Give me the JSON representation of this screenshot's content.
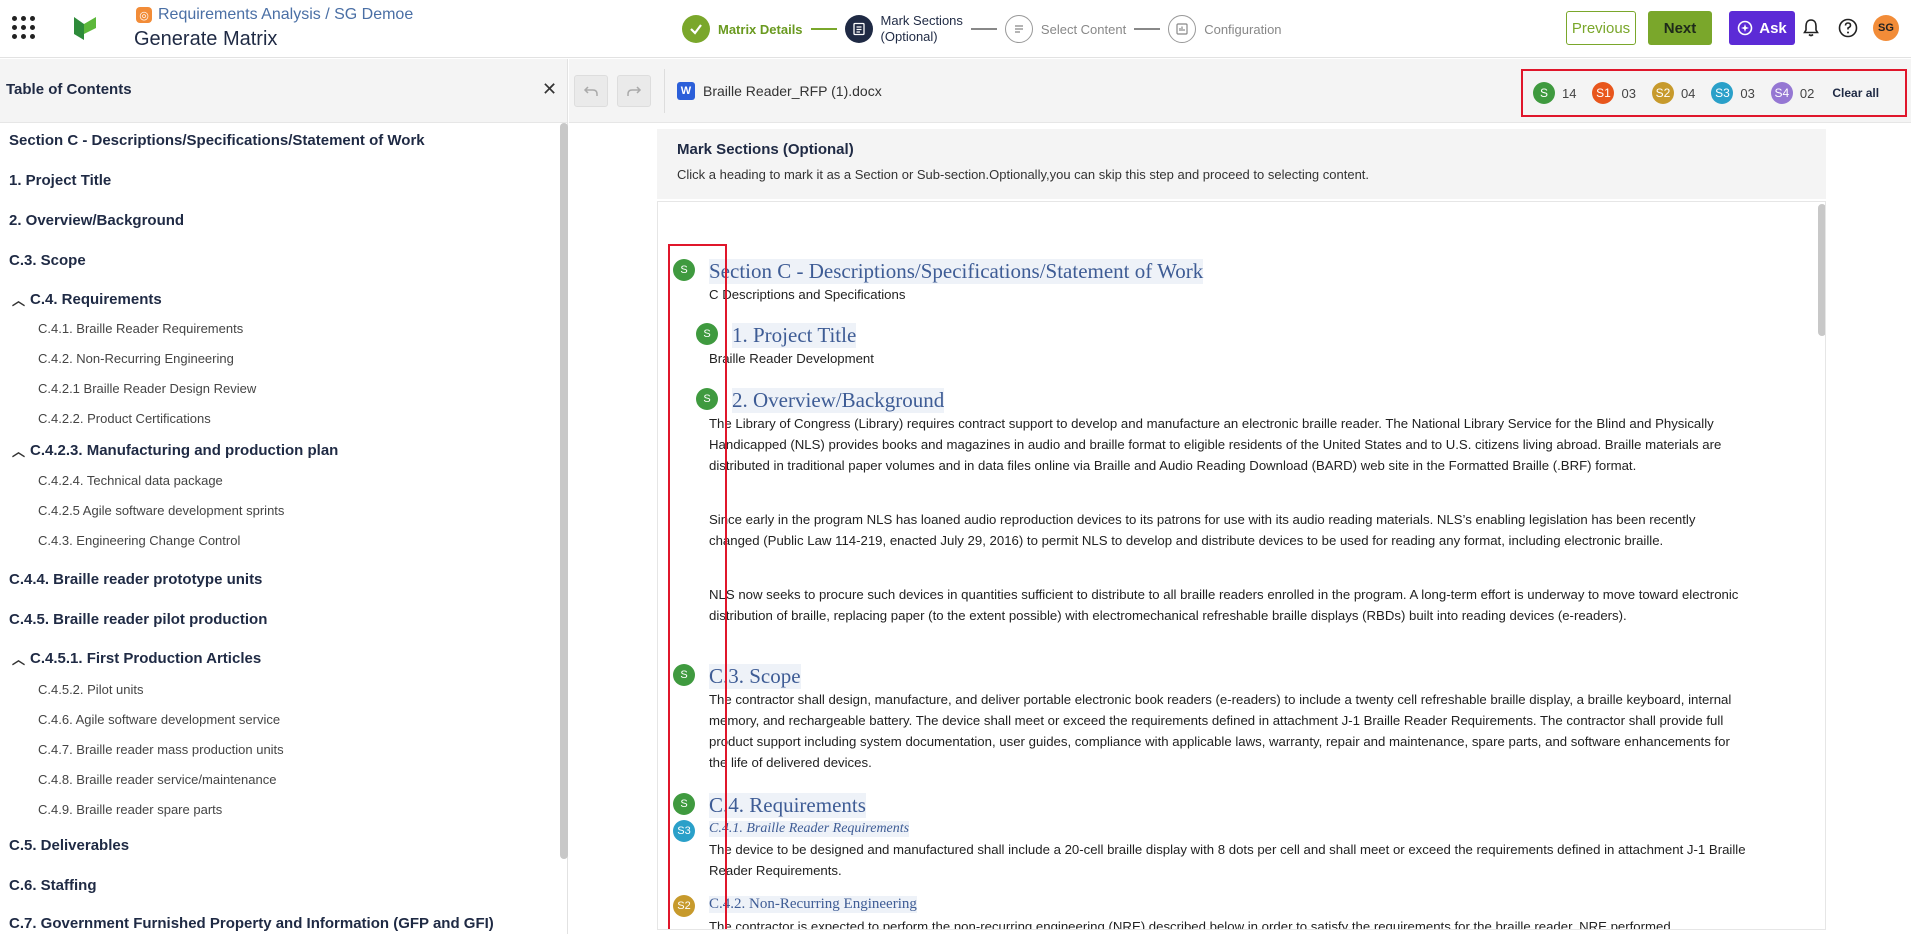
{
  "header": {
    "breadcrumb": "Requirements Analysis / SG Demoe",
    "title": "Generate Matrix",
    "steps": [
      {
        "label": "Matrix Details",
        "state": "done"
      },
      {
        "label_line1": "Mark Sections",
        "label_line2": "(Optional)",
        "state": "active"
      },
      {
        "label": "Select Content",
        "state": "todo"
      },
      {
        "label": "Configuration",
        "state": "todo"
      }
    ],
    "previous_label": "Previous",
    "next_label": "Next",
    "ask_label": "Ask",
    "avatar_initials": "SG",
    "colors": {
      "accent": "#7aa72b",
      "ask": "#5c2bd6",
      "avatar": "#f28c38"
    }
  },
  "sidebar": {
    "title": "Table of Contents",
    "items": [
      {
        "label": "Section C - Descriptions/Specifications/Statement of Work",
        "level": 1
      },
      {
        "label": "1. Project Title",
        "level": 1
      },
      {
        "label": "2. Overview/Background",
        "level": 1
      },
      {
        "label": "C.3. Scope",
        "level": 1
      },
      {
        "label": "C.4. Requirements",
        "level": 1,
        "expanded": true
      },
      {
        "label": "C.4.1. Braille Reader Requirements",
        "level": 2
      },
      {
        "label": "C.4.2. Non-Recurring Engineering",
        "level": 2
      },
      {
        "label": "C.4.2.1 Braille Reader Design Review",
        "level": 2
      },
      {
        "label": "C.4.2.2. Product Certifications",
        "level": 2
      },
      {
        "label": "C.4.2.3. Manufacturing and production plan",
        "level": 1,
        "expanded": true
      },
      {
        "label": "C.4.2.4. Technical data package",
        "level": 2
      },
      {
        "label": "C.4.2.5 Agile software development sprints",
        "level": 2
      },
      {
        "label": "C.4.3. Engineering Change Control",
        "level": 2
      },
      {
        "label": "C.4.4. Braille reader prototype units",
        "level": 1
      },
      {
        "label": "C.4.5. Braille reader pilot production",
        "level": 1
      },
      {
        "label": "C.4.5.1. First Production Articles",
        "level": 1,
        "expanded": true
      },
      {
        "label": "C.4.5.2. Pilot units",
        "level": 2
      },
      {
        "label": "C.4.6. Agile software development service",
        "level": 2
      },
      {
        "label": "C.4.7. Braille reader mass production units",
        "level": 2
      },
      {
        "label": "C.4.8. Braille reader service/maintenance",
        "level": 2
      },
      {
        "label": "C.4.9. Braille reader spare parts",
        "level": 2
      },
      {
        "label": "C.5. Deliverables",
        "level": 1
      },
      {
        "label": "C.6. Staffing",
        "level": 1
      },
      {
        "label": "C.7. Government Furnished Property and Information (GFP and GFI)",
        "level": 1
      }
    ]
  },
  "toolbar": {
    "file_name": "Braille Reader_RFP (1).docx",
    "counters": [
      {
        "tag": "S",
        "count": "14",
        "color": "#3f9a3f"
      },
      {
        "tag": "S1",
        "count": "03",
        "color": "#e8561c"
      },
      {
        "tag": "S2",
        "count": "04",
        "color": "#c79a2c"
      },
      {
        "tag": "S3",
        "count": "03",
        "color": "#2aa0c9"
      },
      {
        "tag": "S4",
        "count": "02",
        "color": "#9577d3"
      }
    ],
    "clear_all": "Clear all"
  },
  "panel": {
    "title": "Mark Sections (Optional)",
    "subtitle": "Click a heading to mark it as a Section or Sub-section.Optionally,you can skip this step and proceed to selecting content."
  },
  "document": {
    "blocks": [
      {
        "type": "heading",
        "text": "Section C - Descriptions/Specifications/Statement of Work",
        "mark": "S"
      },
      {
        "type": "para",
        "text": "C Descriptions and Specifications"
      },
      {
        "type": "heading",
        "text": "1. Project Title",
        "mark": "S"
      },
      {
        "type": "para",
        "text": "Braille Reader Development"
      },
      {
        "type": "heading",
        "text": "2. Overview/Background",
        "mark": "S"
      },
      {
        "type": "para",
        "text": "The Library of Congress (Library) requires contract support to develop and manufacture an electronic braille reader. The National Library Service for the Blind and Physically Handicapped (NLS) provides books and magazines in audio and braille format to eligible residents of the United States and to U.S. citizens living abroad. Braille materials are distributed in traditional paper volumes and in data files online via Braille and Audio Reading Download (BARD) web site in the Formatted Braille (.BRF) format."
      },
      {
        "type": "para",
        "text": "Since early in the program NLS has loaned audio reproduction devices to its patrons for use with its audio reading materials. NLS’s enabling legislation has been recently changed (Public Law 114-219, enacted July 29, 2016) to permit NLS to develop and distribute devices to be used for reading any format, including electronic braille."
      },
      {
        "type": "para",
        "text": "NLS now seeks to procure such devices in quantities sufficient to distribute to all braille readers enrolled in the program. A long-term effort is underway to move toward electronic distribution of braille, replacing paper (to the extent possible) with electromechanical refreshable braille displays (RBDs) built into reading devices (e-readers)."
      },
      {
        "type": "heading",
        "text": "C.3. Scope",
        "mark": "S"
      },
      {
        "type": "para",
        "text": "The contractor shall design, manufacture, and deliver portable electronic book readers (e-readers) to include a twenty cell refreshable braille display, a braille keyboard, internal memory, and rechargeable battery. The device shall meet or exceed the requirements defined in attachment J-1 Braille Reader Requirements. The contractor shall provide full product support including system documentation, user guides, compliance with applicable laws, warranty, repair and maintenance, spare parts, and software enhancements for the life of delivered devices."
      },
      {
        "type": "heading",
        "text": "C.4. Requirements",
        "mark": "S"
      },
      {
        "type": "heading",
        "text": "C.4.1. Braille Reader Requirements",
        "mark": "S3"
      },
      {
        "type": "para",
        "text": "The device to be designed and manufactured shall include a 20-cell braille display with 8 dots per cell and shall meet or exceed the requirements defined in attachment J-1 Braille Reader Requirements."
      },
      {
        "type": "heading",
        "text": "C.4.2. Non-Recurring Engineering",
        "mark": "S2"
      },
      {
        "type": "para",
        "text": "The contractor is expected to perform the non-recurring engineering (NRE) described below in order to satisfy the requirements for the braille reader. NRE performed"
      }
    ]
  }
}
